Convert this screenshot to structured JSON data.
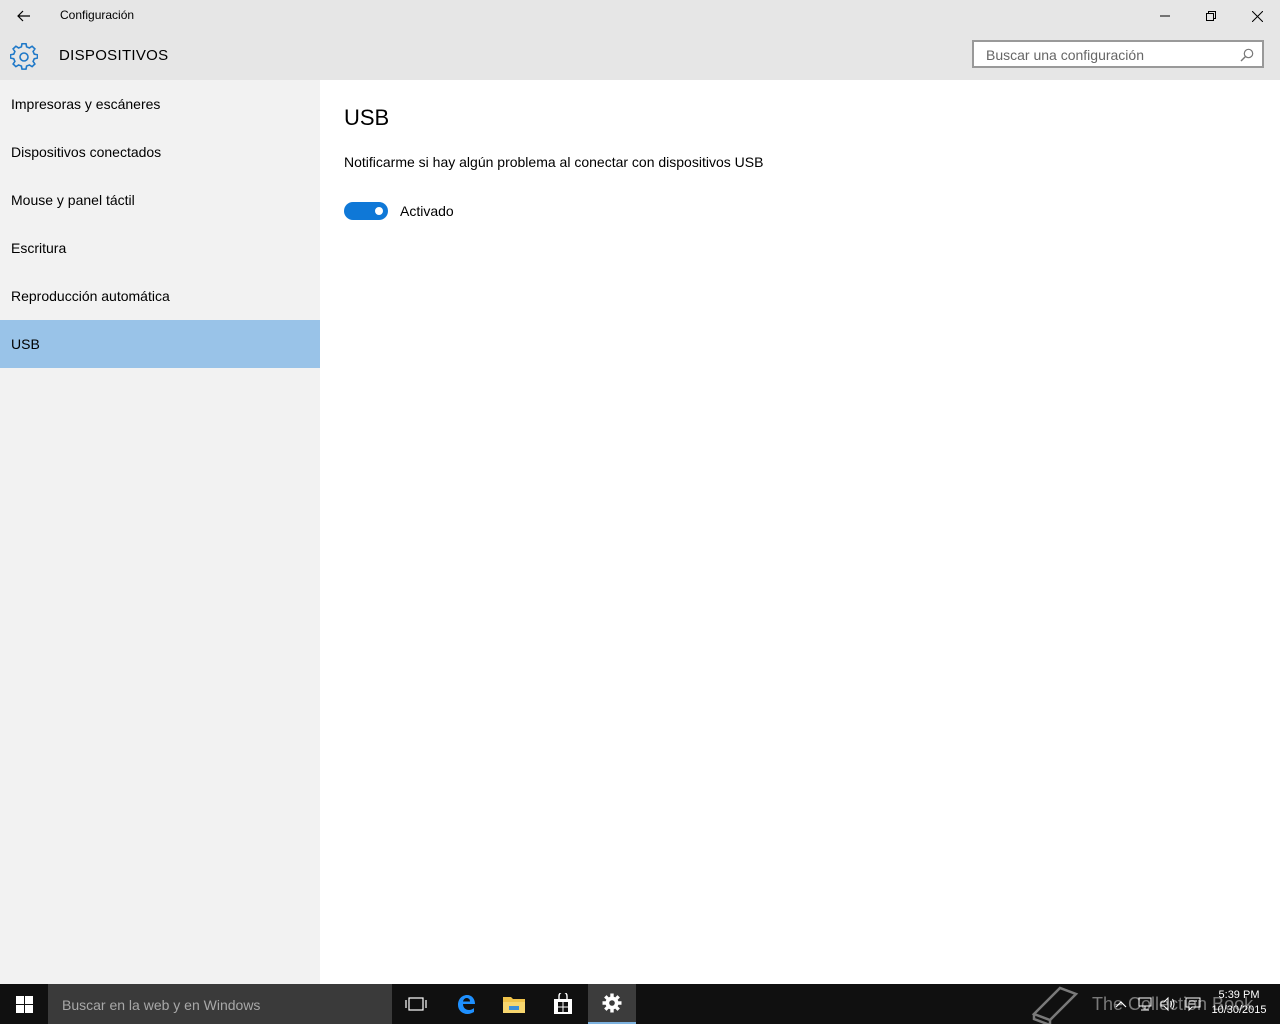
{
  "window": {
    "title": "Configuración",
    "controls": [
      "minimize",
      "restore",
      "close"
    ]
  },
  "header": {
    "section_title": "DISPOSITIVOS",
    "icon": "gear-icon",
    "search_placeholder": "Buscar una configuración"
  },
  "sidebar": {
    "items": [
      {
        "label": "Impresoras y escáneres",
        "selected": false
      },
      {
        "label": "Dispositivos conectados",
        "selected": false
      },
      {
        "label": "Mouse y panel táctil",
        "selected": false
      },
      {
        "label": "Escritura",
        "selected": false
      },
      {
        "label": "Reproducción automática",
        "selected": false
      },
      {
        "label": "USB",
        "selected": true
      }
    ]
  },
  "main": {
    "title": "USB",
    "setting_description": "Notificarme si hay algún problema al conectar con dispositivos USB",
    "toggle_state": "Activado",
    "toggle_on": true
  },
  "taskbar": {
    "search_placeholder": "Buscar en la web y en Windows",
    "apps": [
      "task-view-icon",
      "edge-icon",
      "file-explorer-icon",
      "store-icon",
      "settings-icon"
    ],
    "active_app": "settings-icon",
    "tray": [
      "chevron-up-icon",
      "network-icon",
      "volume-icon",
      "action-center-icon"
    ],
    "time": "5:39 PM",
    "date": "10/30/2015",
    "watermark": "The Collection Book"
  },
  "colors": {
    "accent": "#0f78d7",
    "selected_item": "#99c3e8",
    "header_bg": "#e6e6e6",
    "sidebar_bg": "#f2f2f2",
    "taskbar_bg": "#101010"
  }
}
